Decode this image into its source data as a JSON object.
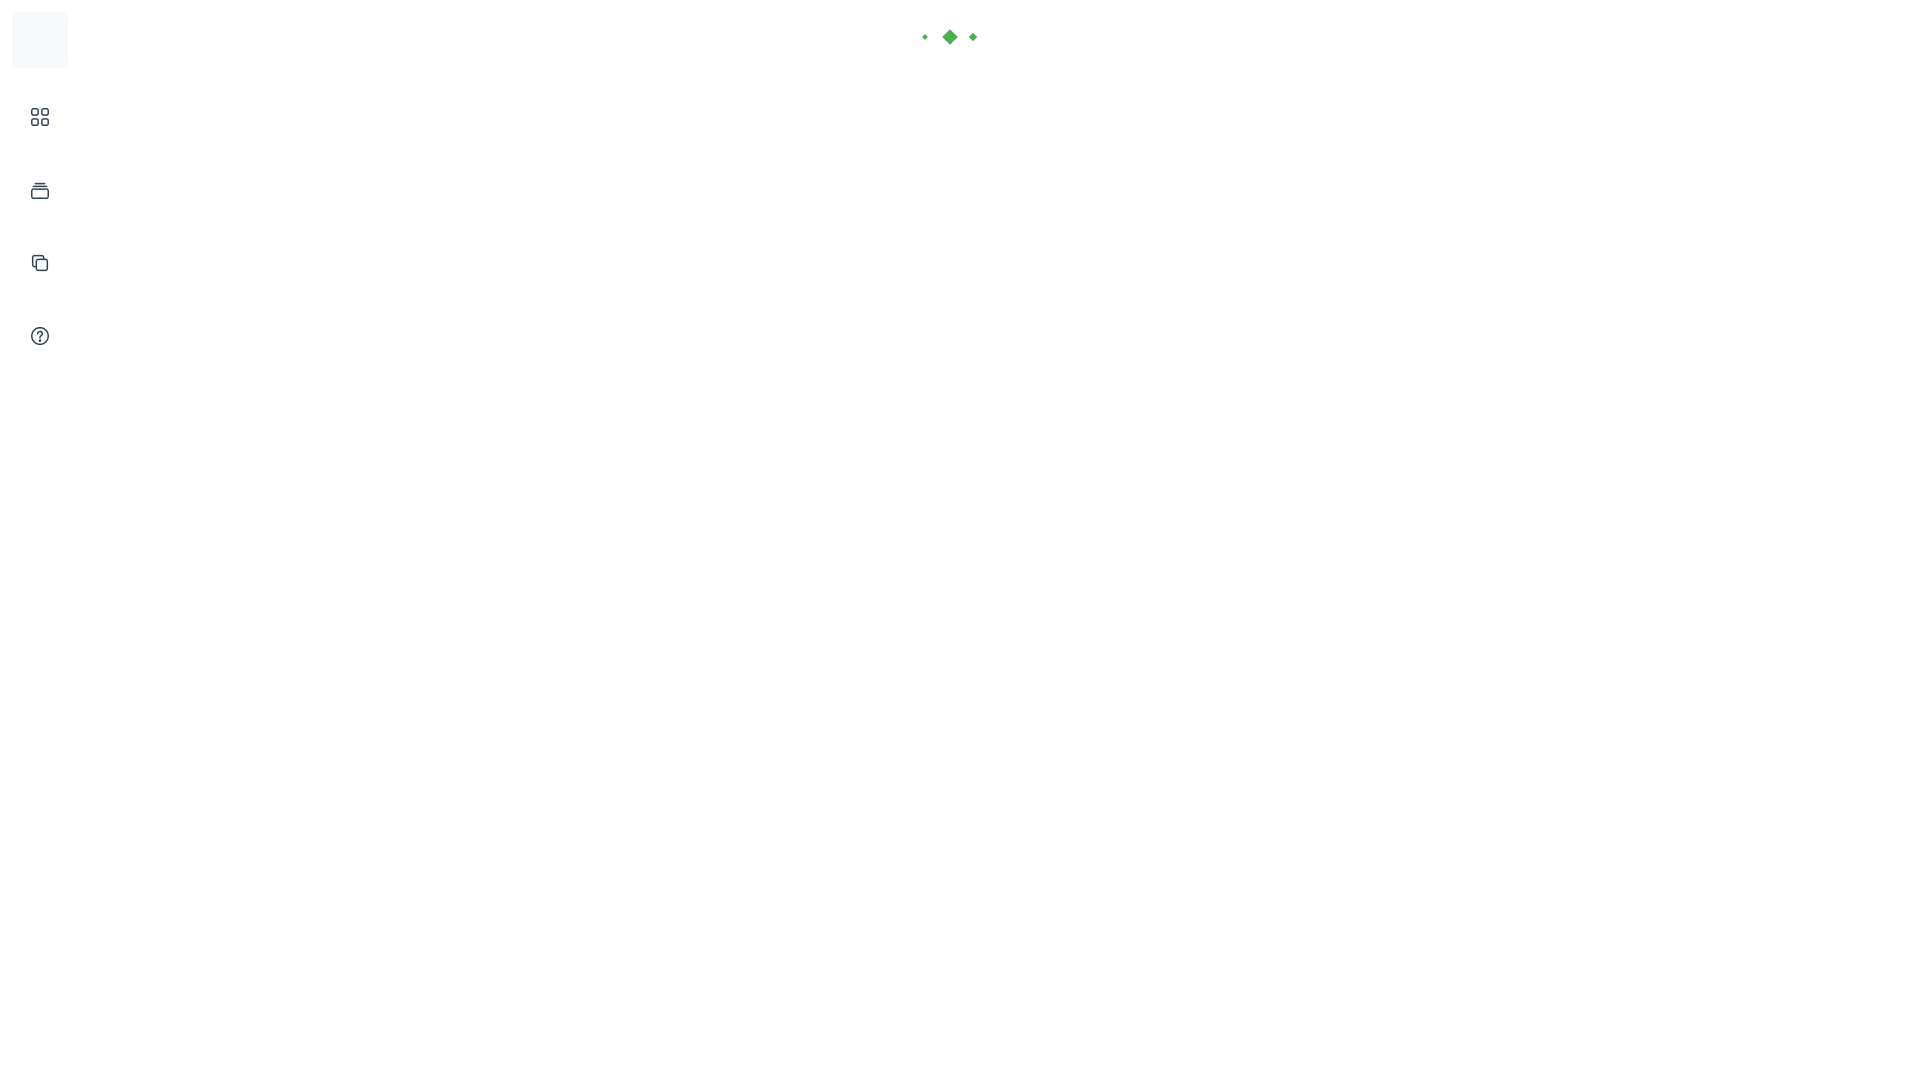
{
  "sidebar": {
    "items": [
      {
        "icon": "grid-icon"
      },
      {
        "icon": "layers-icon"
      },
      {
        "icon": "copy-icon"
      },
      {
        "icon": "help-icon"
      }
    ]
  },
  "loader": {
    "icon": "loading-dots-icon",
    "color": "#4caf50"
  },
  "colors": {
    "icon_stroke": "#334155",
    "logo_bg": "#f7f8fa",
    "page_bg": "#ffffff"
  }
}
